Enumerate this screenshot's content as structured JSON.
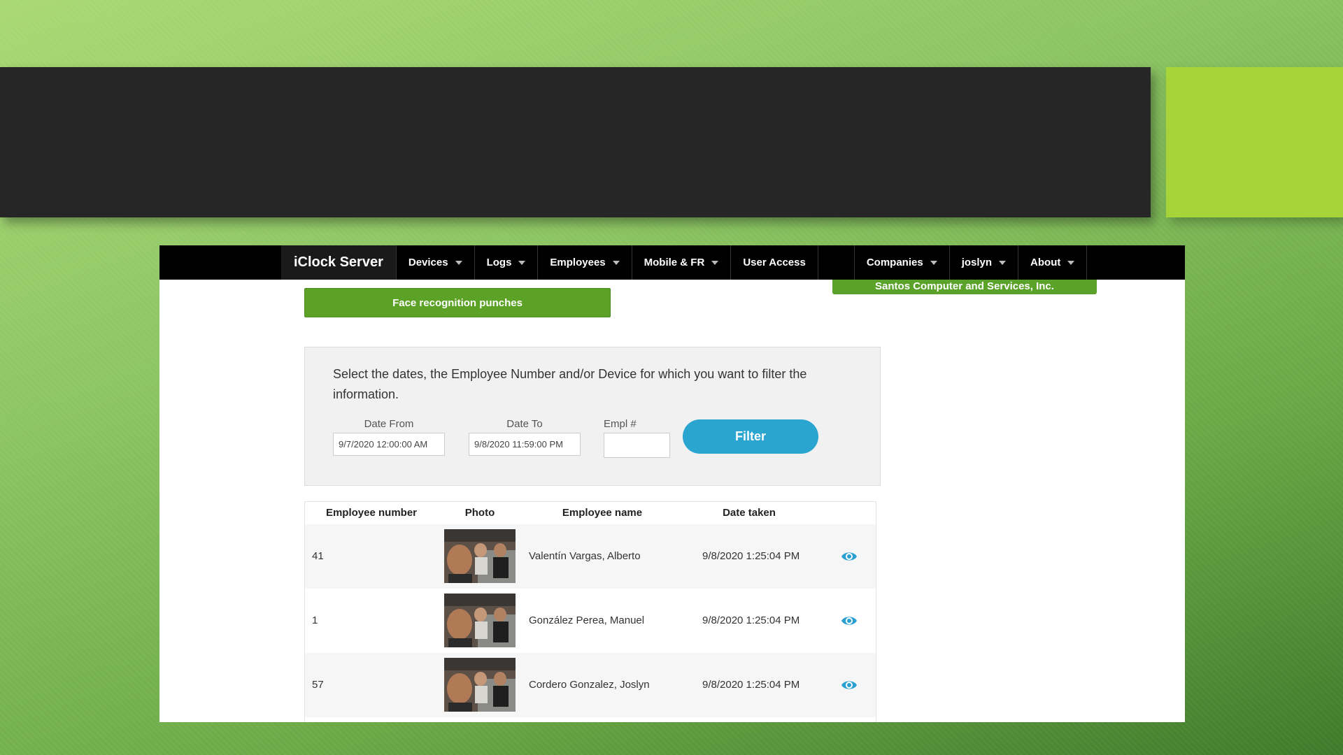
{
  "navbar": {
    "brand": "iClock Server",
    "items": [
      {
        "label": "Devices",
        "dropdown": true
      },
      {
        "label": "Logs",
        "dropdown": true
      },
      {
        "label": "Employees",
        "dropdown": true
      },
      {
        "label": "Mobile & FR",
        "dropdown": true
      },
      {
        "label": "User Access",
        "dropdown": false
      }
    ],
    "right_items": [
      {
        "label": "Companies",
        "dropdown": true
      },
      {
        "label": "joslyn",
        "dropdown": true
      },
      {
        "label": "About",
        "dropdown": true
      }
    ]
  },
  "company_badge": "Santos Computer and Services, Inc.",
  "page_title": "Face recognition punches",
  "filter": {
    "instructions": "Select the dates, the Employee Number and/or Device for which you want to filter the information.",
    "date_from_label": "Date From",
    "date_from_value": "9/7/2020 12:00:00 AM",
    "date_to_label": "Date To",
    "date_to_value": "9/8/2020 11:59:00 PM",
    "empl_label": "Empl #",
    "empl_value": "",
    "button_label": "Filter"
  },
  "table": {
    "headers": [
      "Employee number",
      "Photo",
      "Employee name",
      "Date taken"
    ],
    "rows": [
      {
        "number": "41",
        "name": "Valentín Vargas, Alberto",
        "date": "9/8/2020 1:25:04 PM"
      },
      {
        "number": "1",
        "name": "González Perea, Manuel",
        "date": "9/8/2020 1:25:04 PM"
      },
      {
        "number": "57",
        "name": "Cordero Gonzalez, Joslyn",
        "date": "9/8/2020 1:25:04 PM"
      }
    ]
  },
  "colors": {
    "accent_green": "#5ca227",
    "filter_blue": "#2aa5d0",
    "navbar": "#000000"
  }
}
